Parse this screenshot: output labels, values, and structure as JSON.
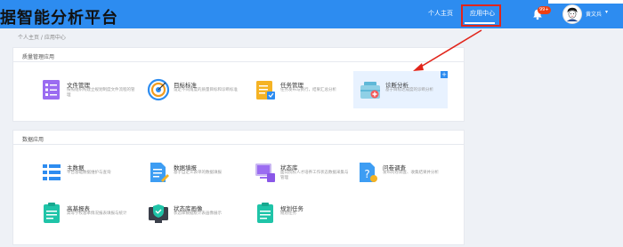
{
  "header": {
    "logo_text": "据智能分析平台",
    "nav_personal": "个人主页",
    "nav_app_center": "应用中心",
    "notification_count": "99+",
    "username": "黄文兵"
  },
  "breadcrumb": "个人主页 / 应用中心",
  "quality": {
    "title": "质量管理应用",
    "cards": [
      {
        "title": "文件管理",
        "desc": "按照组织构建立规划制度文件流程的管理"
      },
      {
        "title": "目标标准",
        "desc": "设定不同角度的质量目标和诊断标准"
      },
      {
        "title": "任务管理",
        "desc": "任务发布与执行，结果汇总分析"
      },
      {
        "title": "诊断分析",
        "desc": "基于目标达成度的诊断分析"
      }
    ]
  },
  "data_apps": {
    "title": "数据应用",
    "cards": [
      {
        "title": "主数据",
        "desc": "平台基础数据维护与查询"
      },
      {
        "title": "数据填报",
        "desc": "基于自定义表单的数据填报"
      },
      {
        "title": "状态库",
        "desc": "面向院校人才培养工作状态数据采集与管理"
      },
      {
        "title": "问卷调查",
        "desc": "发布问卷调查、收集结果并分析"
      },
      {
        "title": "高基报表",
        "desc": "高等学校基本情况报表填报与统计"
      },
      {
        "title": "状态库画像",
        "desc": "状态库数据统计表画像展示"
      },
      {
        "title": "规划任务",
        "desc": "规划任务"
      }
    ]
  },
  "colors": {
    "header_bg": "#2d8cf0",
    "highlight": "#e1251b",
    "badge": "#ed4014"
  }
}
